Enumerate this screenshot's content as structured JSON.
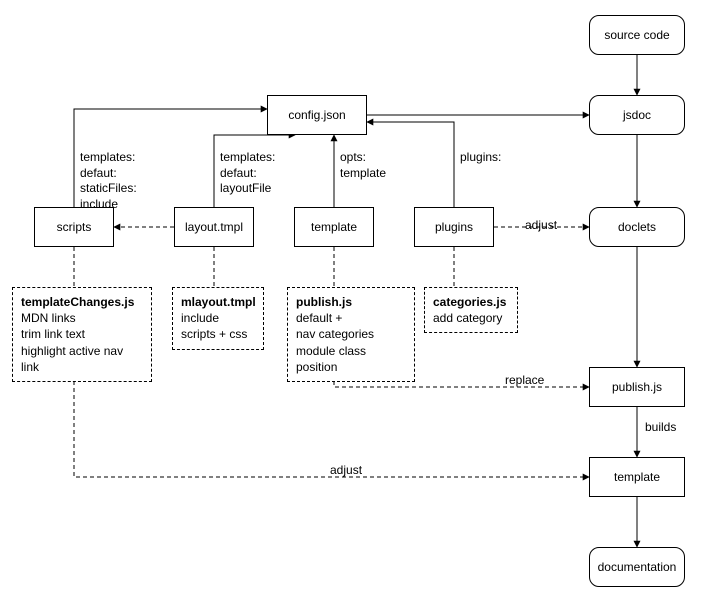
{
  "nodes": {
    "source_code": "source code",
    "jsdoc": "jsdoc",
    "config_json": "config.json",
    "scripts": "scripts",
    "layout_tmpl": "layout.tmpl",
    "template_mid": "template",
    "plugins": "plugins",
    "doclets": "doclets",
    "publish_js": "publish.js",
    "template_lower": "template",
    "documentation": "documentation"
  },
  "notes": {
    "templateChanges": {
      "title": "templateChanges.js",
      "lines": [
        "MDN links",
        "trim link text",
        "highlight active nav link"
      ]
    },
    "mlayout": {
      "title": "mlayout.tmpl",
      "lines": [
        "include",
        "scripts + css"
      ]
    },
    "publish": {
      "title": "publish.js",
      "lines": [
        "default +",
        "nav categories",
        "module class position"
      ]
    },
    "categories": {
      "title": "categories.js",
      "lines": [
        "add category"
      ]
    }
  },
  "edge_labels": {
    "templates_staticfiles": "templates:\ndefaut:\nstaticFiles:\ninclude",
    "templates_layoutfile": "templates:\ndefaut:\nlayoutFile",
    "opts_template": "opts:\ntemplate",
    "plugins_lbl": "plugins:",
    "adjust1": "adjust",
    "replace": "replace",
    "builds": "builds",
    "adjust2": "adjust"
  }
}
